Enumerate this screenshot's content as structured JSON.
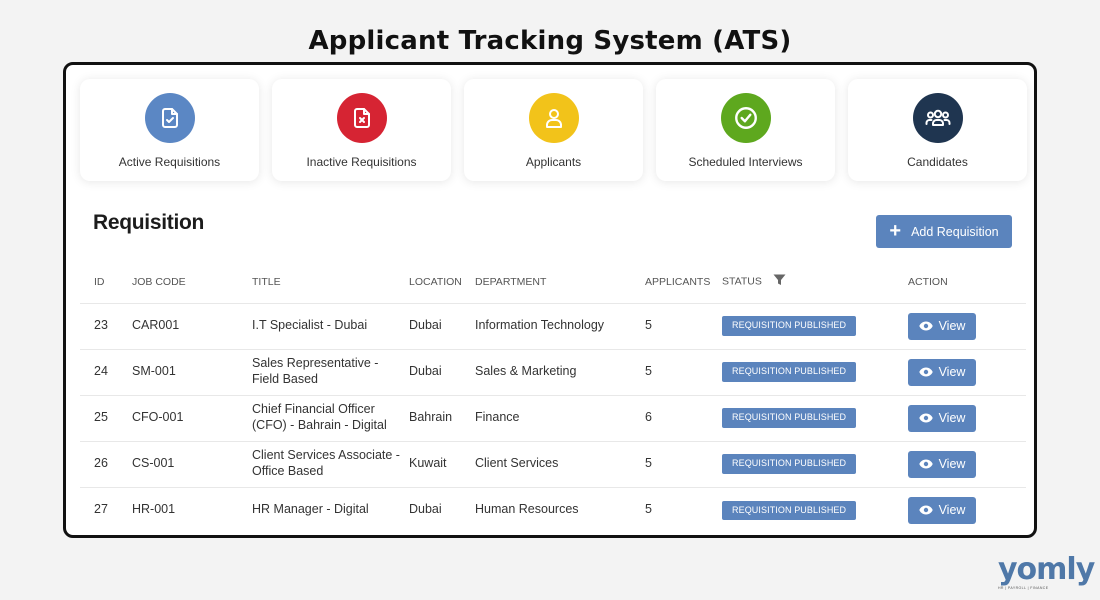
{
  "page_title": "Applicant Tracking System (ATS)",
  "colors": {
    "accent": "#5b84bd",
    "card_blue": "#5b87c4",
    "card_red": "#d62433",
    "card_yellow": "#f2c31a",
    "card_green": "#5ea81e",
    "card_navy": "#1f3550"
  },
  "cards": [
    {
      "label": "Active Requisitions",
      "icon": "document-check-icon"
    },
    {
      "label": "Inactive Requisitions",
      "icon": "document-x-icon"
    },
    {
      "label": "Applicants",
      "icon": "user-icon"
    },
    {
      "label": "Scheduled Interviews",
      "icon": "check-circle-icon"
    },
    {
      "label": "Candidates",
      "icon": "users-icon"
    }
  ],
  "section": {
    "title": "Requisition",
    "add_label": "Add Requisition"
  },
  "table": {
    "headers": [
      "ID",
      "JOB CODE",
      "TITLE",
      "LOCATION",
      "DEPARTMENT",
      "APPLICANTS",
      "STATUS",
      "ACTION"
    ],
    "rows": [
      {
        "id": "23",
        "code": "CAR001",
        "title": "I.T Specialist - Dubai",
        "location": "Dubai",
        "department": "Information Technology",
        "applicants": "5",
        "status": "REQUISITION PUBLISHED",
        "action": "View"
      },
      {
        "id": "24",
        "code": "SM-001",
        "title": "Sales Representative - Field Based",
        "location": "Dubai",
        "department": "Sales & Marketing",
        "applicants": "5",
        "status": "REQUISITION PUBLISHED",
        "action": "View"
      },
      {
        "id": "25",
        "code": "CFO-001",
        "title": "Chief Financial Officer (CFO) - Bahrain - Digital",
        "location": "Bahrain",
        "department": "Finance",
        "applicants": "6",
        "status": "REQUISITION PUBLISHED",
        "action": "View"
      },
      {
        "id": "26",
        "code": "CS-001",
        "title": "Client Services Associate - Office Based",
        "location": "Kuwait",
        "department": "Client Services",
        "applicants": "5",
        "status": "REQUISITION PUBLISHED",
        "action": "View"
      },
      {
        "id": "27",
        "code": "HR-001",
        "title": "HR Manager - Digital",
        "location": "Dubai",
        "department": "Human Resources",
        "applicants": "5",
        "status": "REQUISITION PUBLISHED",
        "action": "View"
      }
    ]
  },
  "logo": {
    "word": "yomly",
    "tagline": "HR | PAYROLL | FINANCE"
  }
}
